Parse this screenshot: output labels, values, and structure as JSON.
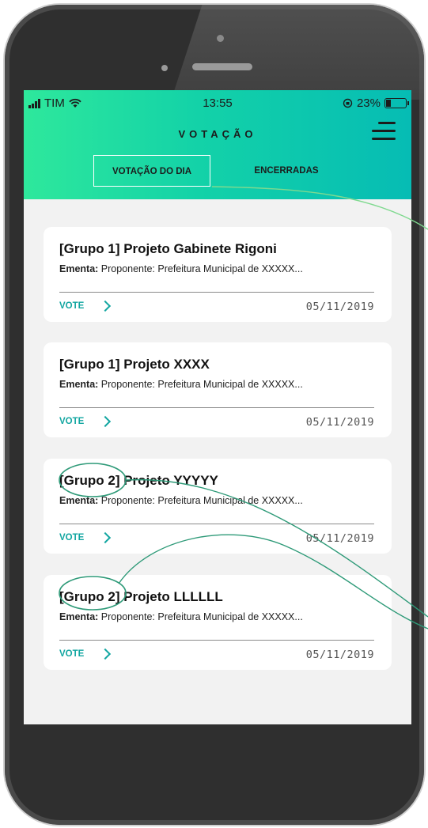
{
  "status_bar": {
    "carrier": "TIM",
    "time": "13:55",
    "battery": "23%"
  },
  "header": {
    "title": "VOTAÇÃO",
    "tabs": [
      {
        "label": "VOTAÇÃO DO DIA"
      },
      {
        "label": "ENCERRADAS"
      }
    ]
  },
  "cards": [
    {
      "title": "[Grupo 1] Projeto Gabinete Rigoni",
      "ementa_label": "Ementa:",
      "ementa_text": " Proponente: Prefeitura Municipal de XXXXX...",
      "vote_label": "VOTE",
      "date": "05/11/2019"
    },
    {
      "title": "[Grupo 1] Projeto XXXX",
      "ementa_label": "Ementa:",
      "ementa_text": " Proponente: Prefeitura Municipal de XXXXX...",
      "vote_label": "VOTE",
      "date": "05/11/2019"
    },
    {
      "title": "[Grupo 2] Projeto YYYYY",
      "ementa_label": "Ementa:",
      "ementa_text": " Proponente: Prefeitura Municipal de XXXXX...",
      "vote_label": "VOTE",
      "date": "05/11/2019"
    },
    {
      "title": "[Grupo 2] Projeto LLLLLL",
      "ementa_label": "Ementa:",
      "ementa_text": " Proponente: Prefeitura Municipal de XXXXX...",
      "vote_label": "VOTE",
      "date": "05/11/2019"
    }
  ],
  "colors": {
    "header_gradient_start": "#2ee89c",
    "header_gradient_end": "#06bcb4",
    "accent": "#12a6a1",
    "annotation": "#2e9a78"
  }
}
